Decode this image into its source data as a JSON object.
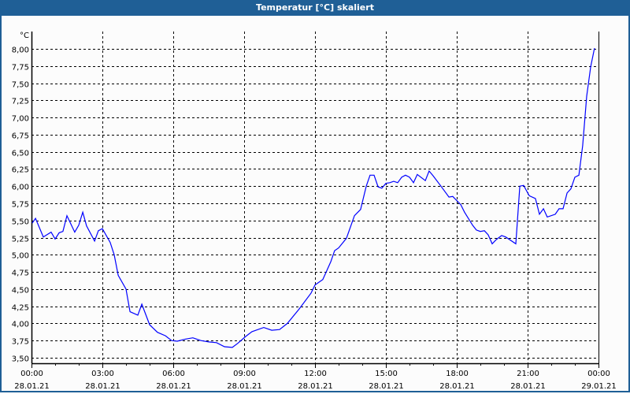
{
  "window": {
    "title": "Temperatur [°C] skaliert"
  },
  "chart_data": {
    "type": "line",
    "title": "Temperatur [°C] skaliert",
    "ylabel": "°C",
    "xlabel": "",
    "ylim": [
      3.5,
      8.0
    ],
    "xlim_hours": [
      0,
      24
    ],
    "grid": true,
    "yticks": [
      "3,50",
      "3,75",
      "4,00",
      "4,25",
      "4,50",
      "4,75",
      "5,00",
      "5,25",
      "5,50",
      "5,75",
      "6,00",
      "6,25",
      "6,50",
      "6,75",
      "7,00",
      "7,25",
      "7,50",
      "7,75",
      "8,00"
    ],
    "xticks": [
      {
        "time": "00:00",
        "date": "28.01.21"
      },
      {
        "time": "03:00",
        "date": "28.01.21"
      },
      {
        "time": "06:00",
        "date": "28.01.21"
      },
      {
        "time": "09:00",
        "date": "28.01.21"
      },
      {
        "time": "12:00",
        "date": "28.01.21"
      },
      {
        "time": "15:00",
        "date": "28.01.21"
      },
      {
        "time": "18:00",
        "date": "28.01.21"
      },
      {
        "time": "21:00",
        "date": "28.01.21"
      },
      {
        "time": "00:00",
        "date": "29.01.21"
      }
    ],
    "series": [
      {
        "name": "Temperatur",
        "color": "#0000ff",
        "points": [
          [
            0.03,
            5.46
          ],
          [
            0.17,
            5.53
          ],
          [
            0.5,
            5.26
          ],
          [
            0.83,
            5.33
          ],
          [
            1.0,
            5.23
          ],
          [
            1.17,
            5.32
          ],
          [
            1.33,
            5.34
          ],
          [
            1.5,
            5.57
          ],
          [
            1.83,
            5.33
          ],
          [
            2.0,
            5.43
          ],
          [
            2.17,
            5.62
          ],
          [
            2.33,
            5.42
          ],
          [
            2.67,
            5.2
          ],
          [
            2.83,
            5.35
          ],
          [
            3.0,
            5.38
          ],
          [
            3.33,
            5.18
          ],
          [
            3.5,
            5.0
          ],
          [
            3.67,
            4.7
          ],
          [
            4.0,
            4.5
          ],
          [
            4.17,
            4.17
          ],
          [
            4.5,
            4.12
          ],
          [
            4.67,
            4.28
          ],
          [
            5.0,
            3.98
          ],
          [
            5.33,
            3.87
          ],
          [
            5.67,
            3.82
          ],
          [
            5.93,
            3.75
          ],
          [
            6.17,
            3.74
          ],
          [
            6.5,
            3.77
          ],
          [
            6.83,
            3.79
          ],
          [
            7.17,
            3.75
          ],
          [
            7.5,
            3.73
          ],
          [
            7.83,
            3.72
          ],
          [
            8.17,
            3.66
          ],
          [
            8.5,
            3.65
          ],
          [
            8.73,
            3.71
          ],
          [
            9.07,
            3.81
          ],
          [
            9.33,
            3.88
          ],
          [
            9.83,
            3.94
          ],
          [
            10.17,
            3.9
          ],
          [
            10.5,
            3.91
          ],
          [
            10.83,
            4.0
          ],
          [
            11.33,
            4.21
          ],
          [
            11.83,
            4.44
          ],
          [
            12.0,
            4.56
          ],
          [
            12.33,
            4.64
          ],
          [
            12.67,
            4.9
          ],
          [
            12.83,
            5.06
          ],
          [
            13.0,
            5.1
          ],
          [
            13.33,
            5.24
          ],
          [
            13.67,
            5.57
          ],
          [
            13.93,
            5.66
          ],
          [
            14.17,
            6.0
          ],
          [
            14.33,
            6.16
          ],
          [
            14.5,
            6.16
          ],
          [
            14.67,
            5.99
          ],
          [
            14.83,
            5.97
          ],
          [
            15.0,
            6.04
          ],
          [
            15.17,
            6.05
          ],
          [
            15.33,
            6.07
          ],
          [
            15.5,
            6.05
          ],
          [
            15.67,
            6.13
          ],
          [
            15.83,
            6.16
          ],
          [
            16.0,
            6.13
          ],
          [
            16.17,
            6.05
          ],
          [
            16.33,
            6.17
          ],
          [
            16.67,
            6.08
          ],
          [
            16.83,
            6.22
          ],
          [
            17.0,
            6.15
          ],
          [
            17.33,
            6.0
          ],
          [
            17.67,
            5.84
          ],
          [
            17.83,
            5.85
          ],
          [
            18.17,
            5.73
          ],
          [
            18.33,
            5.62
          ],
          [
            18.67,
            5.43
          ],
          [
            18.83,
            5.36
          ],
          [
            19.0,
            5.34
          ],
          [
            19.17,
            5.35
          ],
          [
            19.33,
            5.29
          ],
          [
            19.5,
            5.16
          ],
          [
            19.67,
            5.22
          ],
          [
            19.9,
            5.28
          ],
          [
            20.07,
            5.26
          ],
          [
            20.5,
            5.16
          ],
          [
            20.67,
            6.0
          ],
          [
            20.83,
            6.01
          ],
          [
            21.07,
            5.86
          ],
          [
            21.33,
            5.82
          ],
          [
            21.5,
            5.59
          ],
          [
            21.67,
            5.67
          ],
          [
            21.83,
            5.55
          ],
          [
            22.17,
            5.59
          ],
          [
            22.33,
            5.67
          ],
          [
            22.5,
            5.67
          ],
          [
            22.67,
            5.9
          ],
          [
            22.83,
            5.96
          ],
          [
            23.0,
            6.13
          ],
          [
            23.17,
            6.16
          ],
          [
            23.33,
            6.59
          ],
          [
            23.5,
            7.31
          ],
          [
            23.67,
            7.74
          ],
          [
            23.83,
            8.01
          ]
        ]
      }
    ]
  }
}
